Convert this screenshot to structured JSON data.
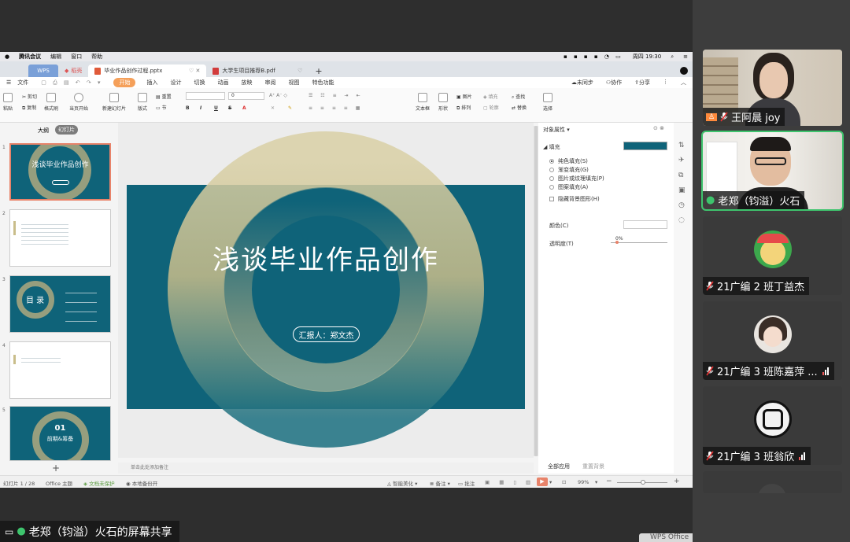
{
  "mac_menubar": {
    "app": "腾讯会议",
    "menus": [
      "编辑",
      "窗口",
      "帮助"
    ],
    "clock": "周四 19:30"
  },
  "wps_tabs": {
    "home": "WPS",
    "templates": "稻壳",
    "doc1": "毕业作品创作过程.pptx",
    "doc2": "大学生项目推荐B.pdf",
    "add": "+"
  },
  "menubar": {
    "file": "文件",
    "items": [
      "开始",
      "插入",
      "设计",
      "切换",
      "动画",
      "放映",
      "审阅",
      "视图",
      "特色功能"
    ],
    "right": [
      "未同步",
      "协作",
      "分享"
    ]
  },
  "ribbon": {
    "paste": "粘贴",
    "cut": "剪切",
    "copy": "复制",
    "format_painter": "格式刷",
    "play_from_current": "当页开始",
    "new_slide": "新建幻灯片",
    "layout": "版式",
    "section": "节",
    "reset": "重置",
    "font_size": "0",
    "textbox": "文本框",
    "shape": "形状",
    "picture": "图片",
    "fill": "填充",
    "arrange": "排列",
    "outline": "轮廓",
    "find": "查找",
    "replace": "替换",
    "select": "选择"
  },
  "thumb_panel": {
    "tab_outline": "大纲",
    "tab_slides": "幻灯片",
    "slide_numbers": [
      "1",
      "2",
      "3",
      "4",
      "5"
    ],
    "thumb1_title": "浅谈毕业作品创作",
    "thumb3_title": "目 录",
    "thumb5_number": "01",
    "thumb5_title": "前期&筹备"
  },
  "slide": {
    "title": "浅谈毕业作品创作",
    "presenter": "汇报人：郑文杰"
  },
  "notes_placeholder": "单击此处添加备注",
  "properties": {
    "header": "对象属性",
    "fill_section": "填充",
    "fill_color": "#0f6379",
    "options": [
      "纯色填充(S)",
      "渐变填充(G)",
      "图片或纹理填充(P)",
      "图案填充(A)"
    ],
    "hide_bg": "隐藏背景图形(H)",
    "color_label": "颜色(C)",
    "transparency_label": "透明度(T)",
    "transparency_value": "0%",
    "apply_all": "全部应用",
    "reset_bg": "重置背景"
  },
  "statusbar": {
    "slide_count": "幻灯片 1 / 28",
    "theme": "Office 主题",
    "doc_unprotected": "文档未保护",
    "local_backup": "本地备份开",
    "smart_beautify": "智能美化",
    "notes": "备注",
    "comments": "批注",
    "zoom": "99%",
    "zoom_minus": "−",
    "zoom_plus": "+"
  },
  "share_label": "老郑（钧溢）火石的屏幕共享",
  "wps_label": "WPS Office",
  "participants": [
    {
      "name": "王阿晨 joy"
    },
    {
      "name": "老郑（钧溢）火石"
    },
    {
      "name": "21广编 2 班丁益杰"
    },
    {
      "name": "21广编 3 班陈嘉萍 ..."
    },
    {
      "name": "21广编 3 班翁欣"
    }
  ],
  "colors": {
    "slide_teal": "#0f6379",
    "ring_gold": "#c9bd8a",
    "wps_orange": "#f5a05a",
    "speaker_green": "#3ec46d"
  }
}
